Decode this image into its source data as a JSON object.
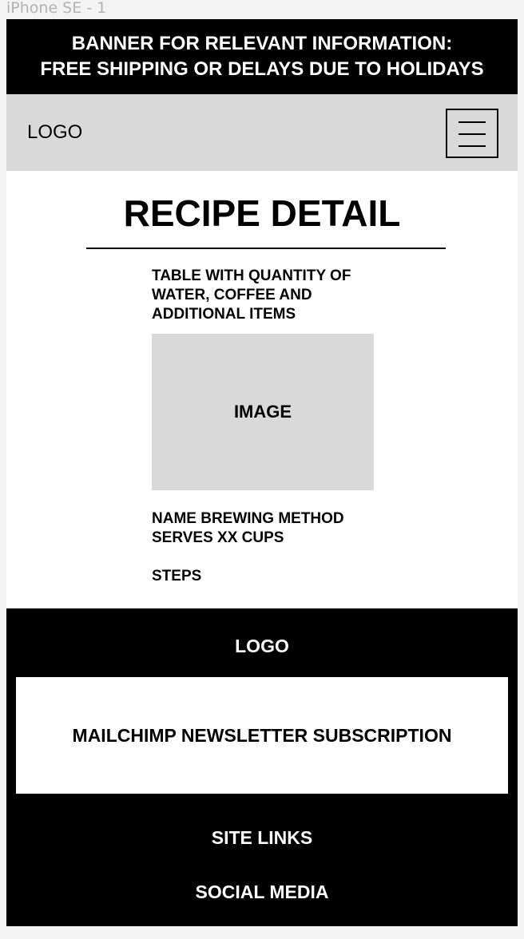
{
  "frame_label": "iPhone SE - 1",
  "banner": {
    "line1": "BANNER FOR RELEVANT INFORMATION:",
    "line2": "FREE SHIPPING OR DELAYS DUE TO HOLIDAYS"
  },
  "header": {
    "logo": "LOGO",
    "menu_icon": "hamburger-menu-icon"
  },
  "main": {
    "title": "RECIPE DETAIL",
    "table_lines": [
      "TABLE WITH QUANTITY OF",
      "WATER, COFFEE AND",
      "ADDITIONAL ITEMS"
    ],
    "image_label": "IMAGE",
    "method_lines": [
      "NAME BREWING METHOD",
      "SERVES XX CUPS"
    ],
    "steps": "STEPS"
  },
  "footer": {
    "logo": "LOGO",
    "newsletter": "MAILCHIMP NEWSLETTER SUBSCRIPTION",
    "site_links": "SITE LINKS",
    "social_media": "SOCIAL MEDIA"
  },
  "colors": {
    "banner_bg": "#000000",
    "header_bg": "#d9d9d9",
    "placeholder_bg": "#d9d9d9",
    "footer_bg": "#000000",
    "canvas_bg": "#f3f3f3"
  }
}
